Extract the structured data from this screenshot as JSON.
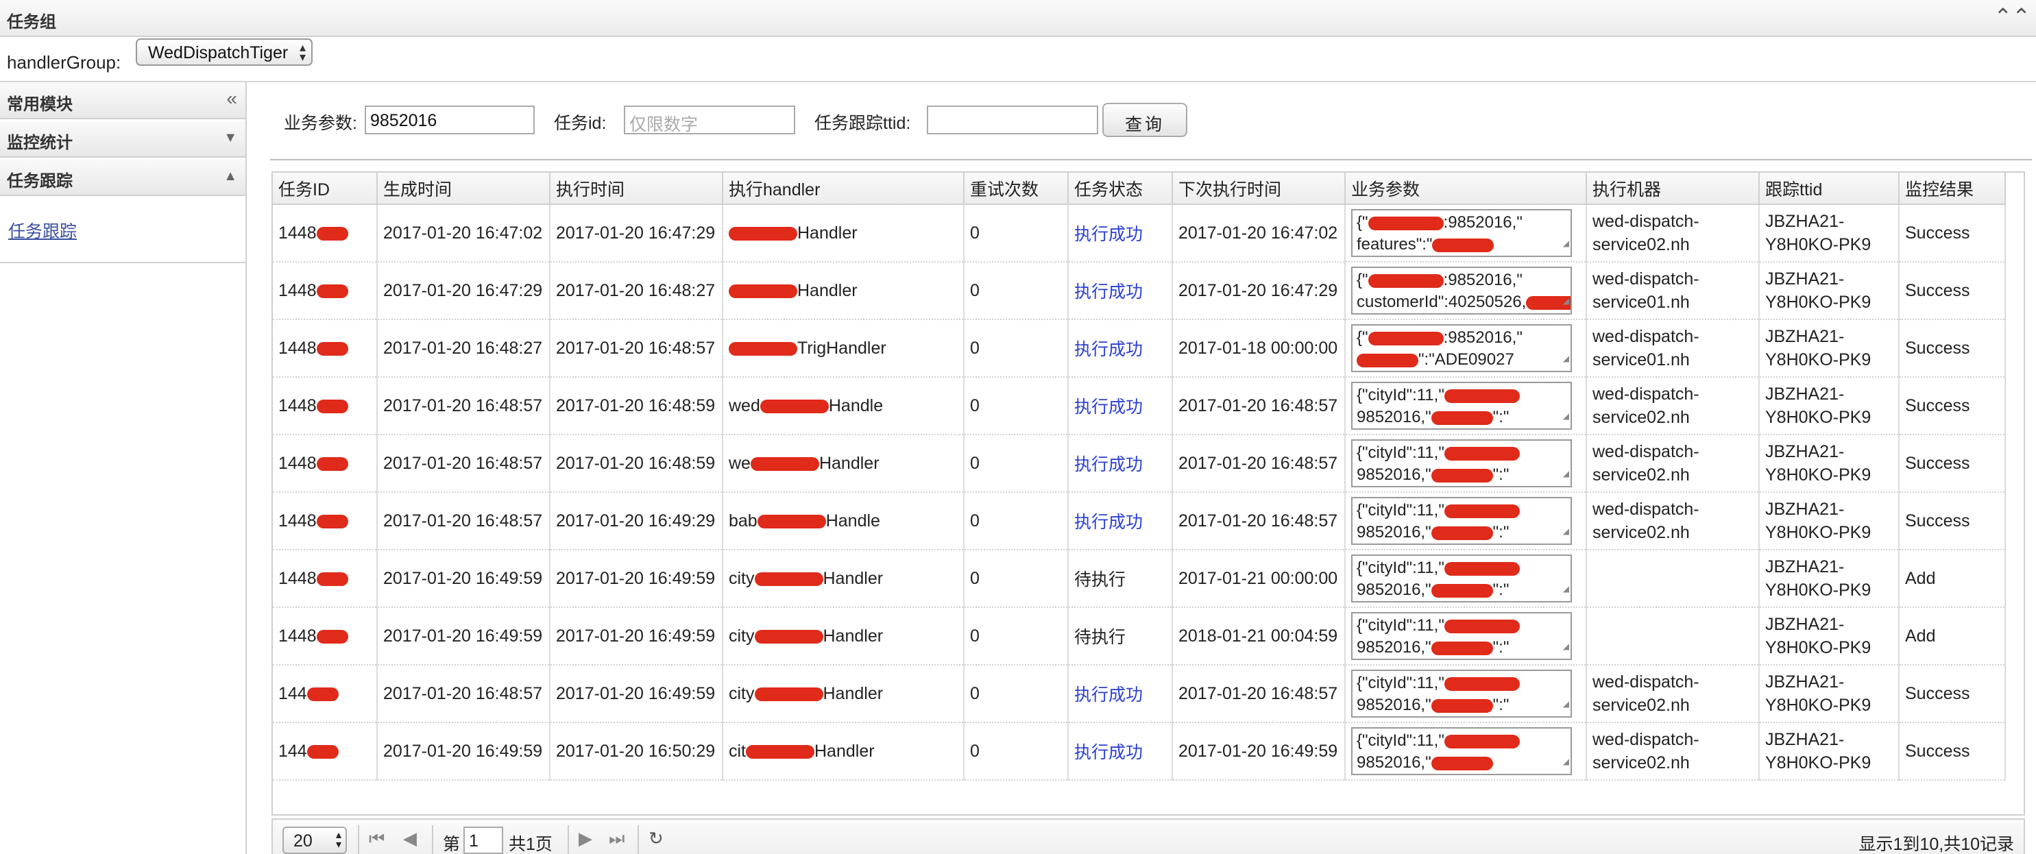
{
  "header": {
    "title": "任务组"
  },
  "handler_group": {
    "label": "handlerGroup:",
    "selected": "WedDispatchTiger"
  },
  "sidebar": {
    "sections": [
      {
        "label": "常用模块"
      },
      {
        "label": "监控统计"
      },
      {
        "label": "任务跟踪"
      }
    ],
    "link": "任务跟踪"
  },
  "search": {
    "biz_label": "业务参数:",
    "biz_value": "9852016",
    "taskid_label": "任务id:",
    "taskid_placeholder": "仅限数字",
    "ttid_label": "任务跟踪ttid:",
    "ttid_value": "",
    "button": "查询"
  },
  "table": {
    "columns": [
      "任务ID",
      "生成时间",
      "执行时间",
      "执行handler",
      "重试次数",
      "任务状态",
      "下次执行时间",
      "业务参数",
      "执行机器",
      "跟踪ttid",
      "监控结果"
    ],
    "rows": [
      {
        "id": "1448",
        "created": "2017-01-20 16:47:02",
        "executed": "2017-01-20 16:47:29",
        "handler_pre": "",
        "handler_post": "Handler",
        "retry": "0",
        "status": "执行成功",
        "next": "2017-01-20 16:47:02",
        "param1": "{\"",
        "param1b": ":9852016,\"",
        "param2": "features\":\"",
        "param2b": "",
        "machine": "wed-dispatch-service02.nh",
        "ttid": "JBZHA21-Y8H0KO-PK9",
        "result": "Success"
      },
      {
        "id": "1448",
        "created": "2017-01-20 16:47:29",
        "executed": "2017-01-20 16:48:27",
        "handler_pre": "",
        "handler_post": "Handler",
        "retry": "0",
        "status": "执行成功",
        "next": "2017-01-20 16:47:29",
        "param1": "{\"",
        "param1b": ":9852016,\"",
        "param2": "customerId\":40250526,",
        "param2b": "",
        "machine": "wed-dispatch-service01.nh",
        "ttid": "JBZHA21-Y8H0KO-PK9",
        "result": "Success"
      },
      {
        "id": "1448",
        "created": "2017-01-20 16:48:27",
        "executed": "2017-01-20 16:48:57",
        "handler_pre": "",
        "handler_post": "TrigHandler",
        "retry": "0",
        "status": "执行成功",
        "next": "2017-01-18 00:00:00",
        "param1": "{\"",
        "param1b": ":9852016,\"",
        "param2": "",
        "param2b": "\":\"ADE09027",
        "machine": "wed-dispatch-service01.nh",
        "ttid": "JBZHA21-Y8H0KO-PK9",
        "result": "Success"
      },
      {
        "id": "1448",
        "created": "2017-01-20 16:48:57",
        "executed": "2017-01-20 16:48:59",
        "handler_pre": "wed",
        "handler_post": "Handle",
        "retry": "0",
        "status": "执行成功",
        "next": "2017-01-20 16:48:57",
        "param1": "{\"cityId\":11,\"",
        "param1b": "",
        "param2": "9852016,\"",
        "param2b": "\":\"",
        "machine": "wed-dispatch-service02.nh",
        "ttid": "JBZHA21-Y8H0KO-PK9",
        "result": "Success"
      },
      {
        "id": "1448",
        "created": "2017-01-20 16:48:57",
        "executed": "2017-01-20 16:48:59",
        "handler_pre": "we",
        "handler_post": "Handler",
        "retry": "0",
        "status": "执行成功",
        "next": "2017-01-20 16:48:57",
        "param1": "{\"cityId\":11,\"",
        "param1b": "",
        "param2": "9852016,\"",
        "param2b": "\":\"",
        "machine": "wed-dispatch-service02.nh",
        "ttid": "JBZHA21-Y8H0KO-PK9",
        "result": "Success"
      },
      {
        "id": "1448",
        "created": "2017-01-20 16:48:57",
        "executed": "2017-01-20 16:49:29",
        "handler_pre": "bab",
        "handler_post": "Handle",
        "retry": "0",
        "status": "执行成功",
        "next": "2017-01-20 16:48:57",
        "param1": "{\"cityId\":11,\"",
        "param1b": "",
        "param2": "9852016,\"",
        "param2b": "\":\"",
        "machine": "wed-dispatch-service02.nh",
        "ttid": "JBZHA21-Y8H0KO-PK9",
        "result": "Success"
      },
      {
        "id": "1448",
        "created": "2017-01-20 16:49:59",
        "executed": "2017-01-20 16:49:59",
        "handler_pre": "city",
        "handler_post": "Handler",
        "retry": "0",
        "status": "待执行",
        "next": "2017-01-21 00:00:00",
        "param1": "{\"cityId\":11,\"",
        "param1b": "",
        "param2": "9852016,\"",
        "param2b": "\":\"",
        "machine": "",
        "ttid": "JBZHA21-Y8H0KO-PK9",
        "result": "Add"
      },
      {
        "id": "1448",
        "created": "2017-01-20 16:49:59",
        "executed": "2017-01-20 16:49:59",
        "handler_pre": "city",
        "handler_post": "Handler",
        "retry": "0",
        "status": "待执行",
        "next": "2018-01-21 00:04:59",
        "param1": "{\"cityId\":11,\"",
        "param1b": "",
        "param2": "9852016,\"",
        "param2b": "\":\"",
        "machine": "",
        "ttid": "JBZHA21-Y8H0KO-PK9",
        "result": "Add"
      },
      {
        "id": "144",
        "created": "2017-01-20 16:48:57",
        "executed": "2017-01-20 16:49:59",
        "handler_pre": "city",
        "handler_post": "Handler",
        "retry": "0",
        "status": "执行成功",
        "next": "2017-01-20 16:48:57",
        "param1": "{\"cityId\":11,\"",
        "param1b": "",
        "param2": "9852016,\"",
        "param2b": "\":\"",
        "machine": "wed-dispatch-service02.nh",
        "ttid": "JBZHA21-Y8H0KO-PK9",
        "result": "Success"
      },
      {
        "id": "144",
        "created": "2017-01-20 16:49:59",
        "executed": "2017-01-20 16:50:29",
        "handler_pre": "cit",
        "handler_post": "Handler",
        "retry": "0",
        "status": "执行成功",
        "next": "2017-01-20 16:49:59",
        "param1": "{\"cityId\":11,\"",
        "param1b": "",
        "param2": "9852016,\"",
        "param2b": "",
        "machine": "wed-dispatch-service02.nh",
        "ttid": "JBZHA21-Y8H0KO-PK9",
        "result": "Success"
      }
    ]
  },
  "pager": {
    "page_size": "20",
    "page_prefix": "第",
    "page_value": "1",
    "page_suffix": "共1页",
    "info": "显示1到10,共10记录"
  },
  "colors": {
    "success_link": "#2a3fd6",
    "redaction": "#e02a1a"
  }
}
